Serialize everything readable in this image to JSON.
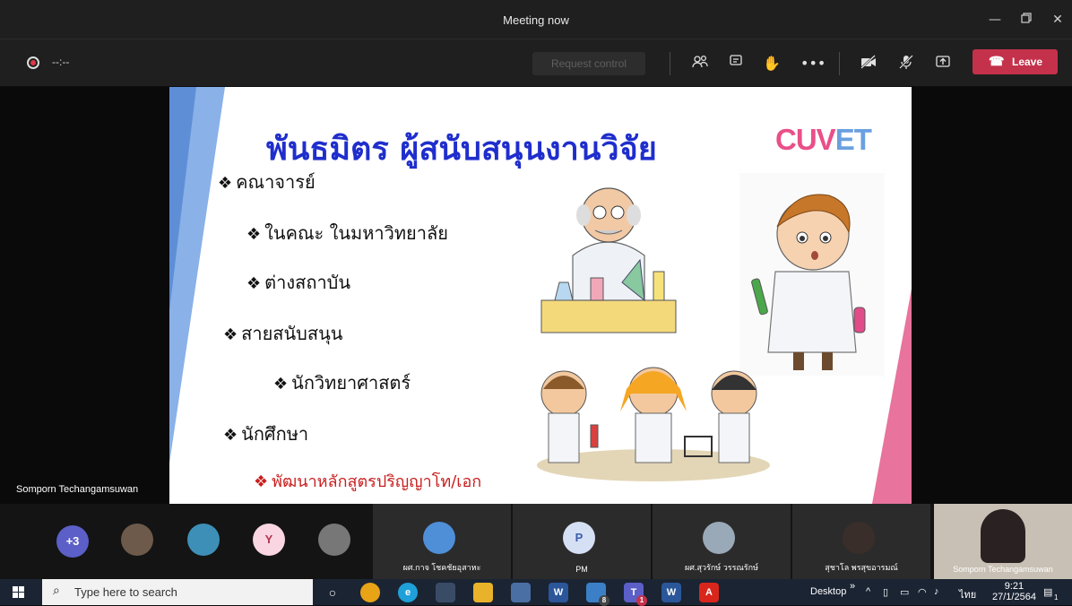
{
  "window": {
    "title": "Meeting now"
  },
  "toolbar": {
    "recording_time": "--:--",
    "request_control": "Request control",
    "leave": "Leave"
  },
  "slide": {
    "title": "พันธมิตร ผู้สนับสนุนงานวิจัย",
    "logo": {
      "part1": "CU",
      "part2": "V",
      "part3": "ET"
    },
    "bullets": [
      {
        "text": "คณาจารย์"
      },
      {
        "text": "ในคณะ ในมหาวิทยาลัย"
      },
      {
        "text": "ต่างสถาบัน"
      },
      {
        "text": "สายสนับสนุน"
      },
      {
        "text": "นักวิทยาศาสตร์"
      },
      {
        "text": "นักศึกษา"
      },
      {
        "text": "พัฒนาหลักสูตรปริญญาโท/เอก"
      }
    ],
    "bullet_glyph": "❖"
  },
  "speaker_name": "Somporn Techangamsuwan",
  "participants": {
    "overflow": "+3",
    "tiles": [
      {
        "name": "ผศ.กาจ โชคชัยอุสาหะ"
      },
      {
        "name": "PM",
        "initial": "P"
      },
      {
        "name": "ผศ.สุวรักษ์ วรรณรักษ์"
      },
      {
        "name": "สุชาโล พรสุขอารมณ์"
      },
      {
        "name": "Somporn Techangamsuwan"
      }
    ],
    "small_avatars": [
      {
        "initial": "Y"
      }
    ]
  },
  "taskbar": {
    "search_placeholder": "Type here to search",
    "desktop_label": "Desktop",
    "language": "ไทย",
    "time": "9:21",
    "date": "27/1/2564",
    "mail_badge": "8",
    "teams_badge": "1",
    "notif_badge": "1"
  },
  "colors": {
    "leave": "#c4314b",
    "title_blue": "#1f2ecc",
    "accent_pink": "#e8739c"
  }
}
